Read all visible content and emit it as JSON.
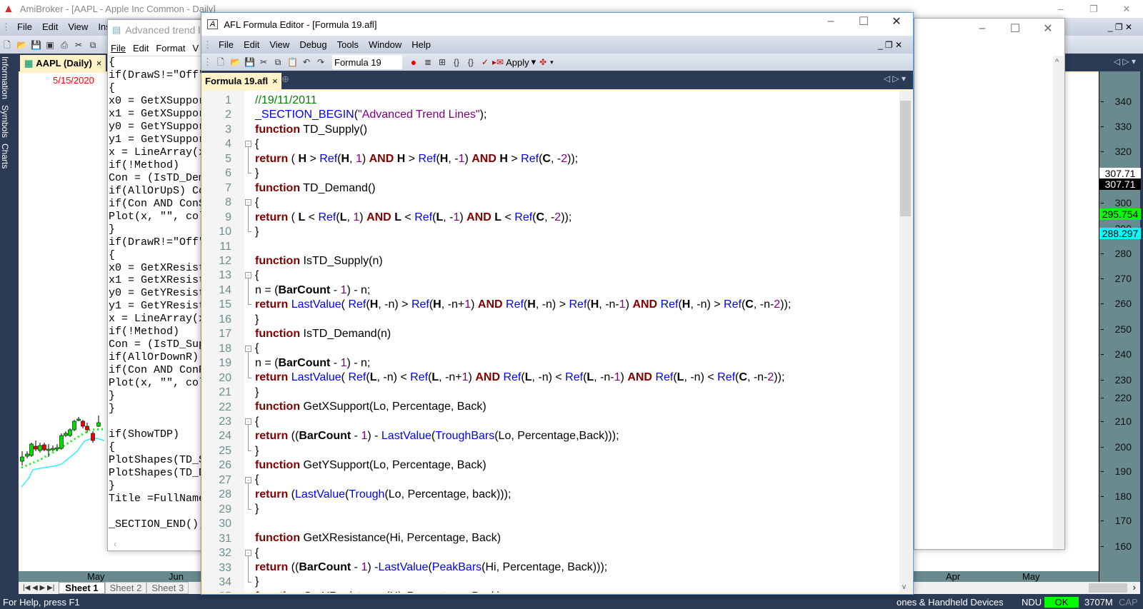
{
  "main": {
    "title": "AmiBroker - [AAPL - Apple Inc Common - Daily]",
    "menu": [
      "File",
      "Edit",
      "View",
      "Insert"
    ],
    "side_tabs": [
      "Information",
      "Symbols",
      "Charts"
    ],
    "chart_tab": "AAPL (Daily)",
    "chart_date": "5/15/2020",
    "date_labels_left": [
      "May",
      "Jun"
    ],
    "date_labels_right": [
      "Apr",
      "May"
    ],
    "axis": [
      "340",
      "330",
      "320",
      "300",
      "290",
      "280",
      "270",
      "260",
      "250",
      "240",
      "230",
      "220",
      "210",
      "200",
      "190",
      "180",
      "170",
      "160"
    ],
    "badges": [
      {
        "text": "307.71",
        "bg": "#ffffff",
        "fg": "#000000"
      },
      {
        "text": "307.71",
        "bg": "#000000",
        "fg": "#ffffff"
      },
      {
        "text": "295.754",
        "bg": "#00ff00",
        "fg": "#000000"
      },
      {
        "text": "288.297",
        "bg": "#00ffff",
        "fg": "#000000"
      }
    ],
    "sheets": [
      "Sheet 1",
      "Sheet 2",
      "Sheet 3"
    ],
    "status": {
      "help": "For Help, press F1",
      "category": "ones & Handheld Devices",
      "ndu": "NDU",
      "ok": "OK",
      "mem": "3707M",
      "cap": "CAP"
    }
  },
  "notepad": {
    "title": "Advanced trend li",
    "menu": [
      "File",
      "Edit",
      "Format",
      "V"
    ],
    "lines": [
      "{",
      "if(DrawS!=\"Off\"",
      "{",
      "x0 = GetXSupport",
      "x1 = GetXSupport",
      "y0 = GetYSupport",
      "y1 = GetYSupport",
      "x = LineArray(x0",
      "if(!Method)",
      "Con = (IsTD_Dema",
      "if(AllOrUpS) Con",
      "if(Con AND ConS",
      "Plot(x, \"\", colo",
      "}",
      "if(DrawR!=\"Off\"",
      "{",
      "x0 = GetXResista",
      "x1 = GetXResista",
      "y0 = GetYResista",
      "y1 = GetYResista",
      "x = LineArray(x0",
      "if(!Method)",
      "Con = (IsTD_Sup",
      "if(AllOrDownR) C",
      "if(Con AND ConR",
      "Plot(x, \"\", colo",
      "}",
      "}",
      "",
      "if(ShowTDP)",
      "{",
      "PlotShapes(TD_S",
      "PlotShapes(TD_D",
      "}",
      "Title =FullName",
      "",
      "_SECTION_END();"
    ]
  },
  "editor": {
    "title": "AFL Formula Editor - [Formula 19.afl]",
    "menu": [
      "File",
      "Edit",
      "View",
      "Debug",
      "Tools",
      "Window",
      "Help"
    ],
    "formula_name": "Formula 19",
    "apply_label": "Apply",
    "tab": "Formula 19.afl",
    "fold_lines": [
      4,
      8,
      13,
      18,
      23,
      27,
      32
    ],
    "code": [
      "{c|//19/11/2011}",
      "{f|_SECTION_BEGIN}({s|\"Advanced Trend Lines\"});",
      "{k|function} TD_Supply()",
      "{",
      "{k|return} ( {v|H} > {f|Ref}({v|H}, {n|1}) {k|AND} {v|H} > {f|Ref}({v|H}, -{n|1}) {k|AND} {v|H} > {f|Ref}({v|C}, -{n|2}));",
      "}",
      "{k|function} TD_Demand()",
      "{",
      "{k|return} ( {v|L} < {f|Ref}({v|L}, {n|1}) {k|AND} {v|L} < {f|Ref}({v|L}, -{n|1}) {k|AND} {v|L} < {f|Ref}({v|C}, -{n|2}));",
      "}",
      "",
      "{k|function} IsTD_Supply(n)",
      "{",
      "n = ({v|BarCount} - {n|1}) - n;",
      "{k|return} {f|LastValue}( {f|Ref}({v|H}, -n) > {f|Ref}({v|H}, -n+{n|1}) {k|AND} {f|Ref}({v|H}, -n) > {f|Ref}({v|H}, -n-{n|1}) {k|AND} {f|Ref}({v|H}, -n) > {f|Ref}({v|C}, -n-{n|2}));",
      "}",
      "{k|function} IsTD_Demand(n)",
      "{",
      "n = ({v|BarCount} - {n|1}) - n;",
      "{k|return} {f|LastValue}( {f|Ref}({v|L}, -n) < {f|Ref}({v|L}, -n+{n|1}) {k|AND} {f|Ref}({v|L}, -n) < {f|Ref}({v|L}, -n-{n|1}) {k|AND} {f|Ref}({v|L}, -n) < {f|Ref}({v|C}, -n-{n|2}));",
      "}",
      "{k|function} GetXSupport(Lo, Percentage, Back)",
      "{",
      "{k|return} (({v|BarCount} - {n|1}) - {f|LastValue}({f|TroughBars}(Lo, Percentage,Back)));",
      "}",
      "{k|function} GetYSupport(Lo, Percentage, Back)",
      "{",
      "{k|return} ({f|LastValue}({f|Trough}(Lo, Percentage, back)));",
      "}",
      "",
      "{k|function} GetXResistance(Hi, Percentage, Back)",
      "{",
      "{k|return} (({v|BarCount} - {n|1}) -{f|LastValue}({f|PeakBars}(Hi, Percentage, Back)));",
      "}",
      "{k|function} GetYResistance(Hi, Percentage, Back)"
    ]
  },
  "colors": {
    "navy": "#2b3a55",
    "axis": "#698a8e",
    "ok": "#00ff00"
  }
}
